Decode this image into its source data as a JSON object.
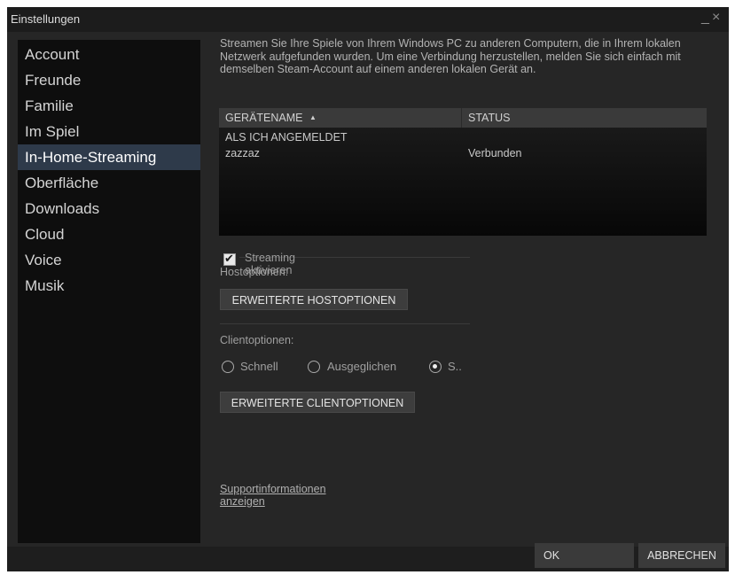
{
  "window": {
    "title": "Einstellungen",
    "minimize_glyph": "_",
    "close_glyph": "×"
  },
  "sidebar": {
    "items": [
      {
        "label": "Account"
      },
      {
        "label": "Freunde"
      },
      {
        "label": "Familie"
      },
      {
        "label": "Im Spiel"
      },
      {
        "label": "In-Home-Streaming",
        "active": true
      },
      {
        "label": "Oberfläche"
      },
      {
        "label": "Downloads"
      },
      {
        "label": "Cloud"
      },
      {
        "label": "Voice"
      },
      {
        "label": "Musik"
      }
    ]
  },
  "main": {
    "intro_text": "Streamen Sie Ihre Spiele von Ihrem Windows PC zu anderen Computern, die in Ihrem lokalen Netzwerk aufgefunden wurden. Um eine Verbindung herzustellen, melden Sie sich einfach mit demselben Steam-Account auf einem anderen lokalen Gerät an.",
    "device_table": {
      "col_name": "GERÄTENAME",
      "sort_indicator": "▲",
      "col_status": "STATUS",
      "group_label": "ALS ICH ANGEMELDET",
      "rows": [
        {
          "name": "zazzaz",
          "status": "Verbunden"
        }
      ]
    },
    "streaming_checkbox": {
      "label": "Streaming aktivieren",
      "checked": true
    },
    "host_options_label": "Hostoptionen:",
    "host_options_button": "ERWEITERTE HOSTOPTIONEN",
    "client_options_label": "Clientoptionen:",
    "client_radio": [
      {
        "label": "Schnell",
        "checked": false
      },
      {
        "label": "Ausgeglichen",
        "checked": false
      },
      {
        "label": "S..",
        "checked": true
      }
    ],
    "client_options_button": "ERWEITERTE CLIENTOPTIONEN",
    "support_link": "Supportinformationen anzeigen"
  },
  "footer": {
    "ok_label": "OK",
    "cancel_label": "ABBRECHEN"
  },
  "colors": {
    "window_bg": "#262626",
    "sidebar_bg": "#0e0e0e",
    "active_item_bg": "#2e3a4a"
  }
}
